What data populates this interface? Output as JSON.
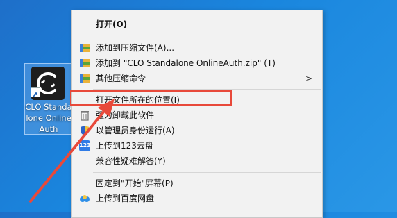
{
  "desktop": {
    "shortcut_label": "CLO Standalone OnlineAuth"
  },
  "menu": {
    "items": [
      {
        "label": "打开(O)"
      },
      {
        "label": "添加到压缩文件(A)..."
      },
      {
        "label": "添加到 \"CLO Standalone OnlineAuth.zip\" (T)"
      },
      {
        "label": "其他压缩命令"
      },
      {
        "label": "打开文件所在的位置(I)"
      },
      {
        "label": "强力卸载此软件"
      },
      {
        "label": "以管理员身份运行(A)"
      },
      {
        "label": "上传到123云盘"
      },
      {
        "label": "兼容性疑难解答(Y)"
      },
      {
        "label": "固定到\"开始\"屏幕(P)"
      },
      {
        "label": "上传到百度网盘"
      }
    ],
    "submenu_indicator": ">",
    "badge_123": "123"
  },
  "colors": {
    "annotation": "#e8493a",
    "menu_bg": "#f2f2f2",
    "desktop_blue": "#1a86de"
  }
}
